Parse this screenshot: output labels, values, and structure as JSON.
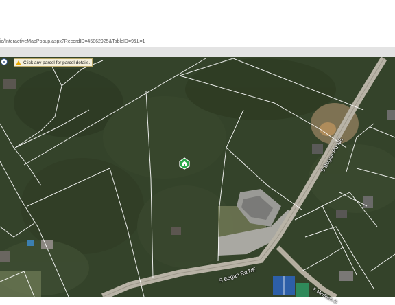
{
  "browser": {
    "url": "ic/InteractiveMapPopup.aspx?RecordID=45862925&TableID=9&L=1"
  },
  "map": {
    "hint_text": "Click any parcel for parcel details.",
    "road_labels": {
      "s_bogan_north": "S Bogan Rd NE",
      "s_bogan_south": "S Bogan Rd NE",
      "e_madison": "E Madison D"
    },
    "icons": {
      "locate": "crosshair-icon",
      "warning": "warning-icon",
      "marker": "home-marker-icon"
    },
    "colors": {
      "hint_bg": "#f5f0dc",
      "marker": "#2ba84a",
      "parcel_lines": "#ffffff"
    }
  }
}
